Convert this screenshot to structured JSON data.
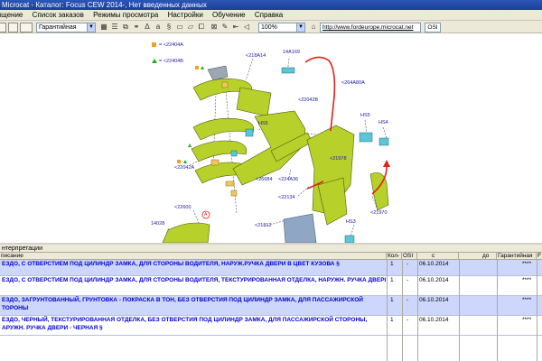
{
  "window": {
    "title": "Microcat - Каталог: Focus CEW 2014-, Нет введенных данных"
  },
  "menu": [
    "Выщение",
    "Список заказов",
    "Режимы просмотра",
    "Настройки",
    "Обучение",
    "Справка"
  ],
  "toolbar": {
    "mode_select": "Гарантийная",
    "zoom_select": "100%",
    "url": "http://www.fordeurope.microcat.net",
    "osi_label": "OSI"
  },
  "colors": {
    "titlebar": "#1c3f98",
    "part_fill": "#b7d02a",
    "label_blue": "#1a1aa6",
    "row_highlight": "#cdd7fb",
    "arrow_red": "#e0221b"
  },
  "diagram": {
    "legend": [
      {
        "symbol": "orange-square-icon",
        "text": "= <22404A"
      },
      {
        "symbol": "green-triangle-icon",
        "text": "= <22404B"
      }
    ],
    "labels": [
      "<218A14",
      "14A169",
      "<264A80A",
      "<22042B",
      "HS5",
      "HS5",
      "HS4",
      "<22042A",
      "<26684",
      "<224A36",
      "<21978",
      "<22134",
      "<22600",
      "14028",
      "<21812",
      "<21970",
      "HS3",
      "A"
    ]
  },
  "parts_panel": {
    "title": "нтерпретации",
    "columns": [
      "писание",
      "Кол-",
      "OSI",
      "с",
      "до",
      "Гарантийная",
      "F"
    ],
    "rows": [
      {
        "description": "ЕЗДО, С ОТВЕРСТИЕМ ПОД ЦИЛИНДР ЗАМКА, ДЛЯ СТОРОНЫ ВОДИТЕЛЯ, НАРУЖ.РУЧКА ДВЕРИ В ЦВЕТ КУЗОВА §",
        "qty": "1",
        "osi": "-",
        "from": "06.10.2014",
        "to": "",
        "warranty": "****"
      },
      {
        "description": "ЕЗДО, С ОТВЕРСТИЕМ ПОД ЦИЛИНДР ЗАМКА, ДЛЯ СТОРОНЫ ВОДИТЕЛЯ, ТЕКСТУРИРОВАННАЯ ОТДЕЛКА, НАРУЖН. РУЧКА ДВЕРИ - ЧЕРНАЯ §",
        "qty": "1",
        "osi": "-",
        "from": "06.10.2014",
        "to": "",
        "warranty": "****"
      },
      {
        "description_lines": [
          "ЕЗДО, ЗАГРУНТОВАННЫЙ, ГРУНТОВКА - ПОКРАСКА В ТОН, БЕЗ ОТВЕРСТИЯ ПОД ЦИЛИНДР ЗАМКА, ДЛЯ ПАССАЖИРСКОЙ",
          "ТОРОНЫ"
        ],
        "qty": "1",
        "osi": "-",
        "from": "06.10.2014",
        "to": "",
        "warranty": "****"
      },
      {
        "description_lines": [
          "ЕЗДО, ЧЕРНЫЙ, ТЕКСТУРИРОВАННАЯ ОТДЕЛКА, БЕЗ ОТВЕРСТИЯ ПОД ЦИЛИНДР ЗАМКА, ДЛЯ ПАССАЖИРСКОЙ СТОРОНЫ,",
          "АРУЖН. РУЧКА ДВЕРИ - ЧЕРНАЯ §"
        ],
        "qty": "1",
        "osi": "-",
        "from": "06.10.2014",
        "to": "",
        "warranty": "****"
      }
    ]
  }
}
